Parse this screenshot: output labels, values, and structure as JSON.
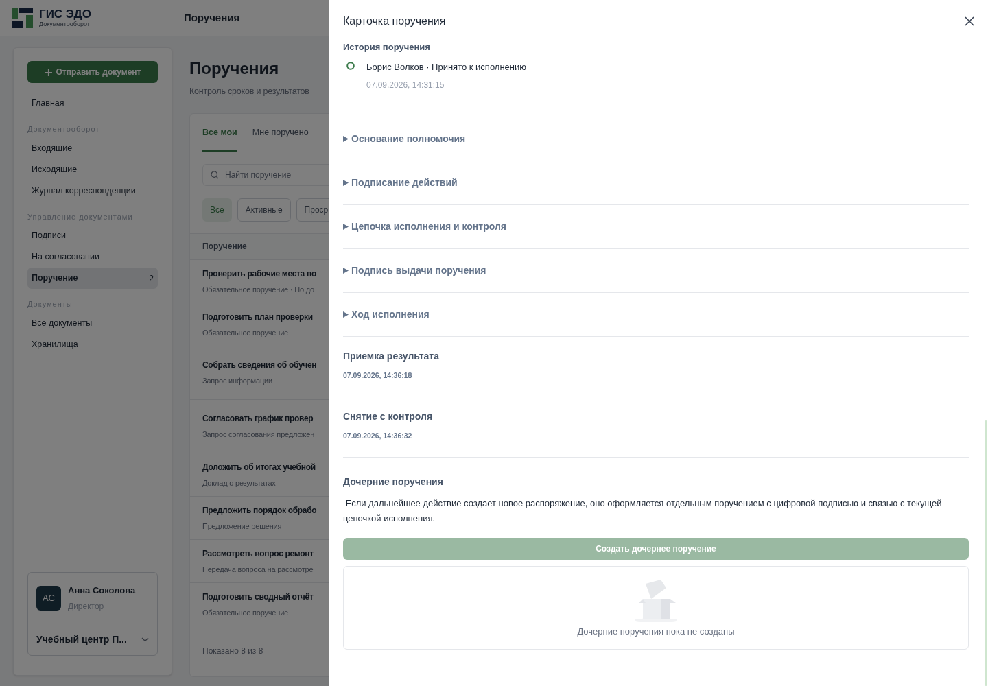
{
  "app": {
    "name": "ГИС ЭДО",
    "subtitle": "Документооборот",
    "page_title": "Поручения"
  },
  "sidebar": {
    "action": "Отправить документ",
    "items": [
      {
        "kind": "link",
        "label": "Главная",
        "selected": false
      },
      {
        "kind": "section",
        "label": "Документооборот"
      },
      {
        "kind": "link",
        "label": "Входящие",
        "selected": false
      },
      {
        "kind": "link",
        "label": "Исходящие",
        "selected": false
      },
      {
        "kind": "link",
        "label": "Журнал корреспонденции",
        "selected": false
      },
      {
        "kind": "section",
        "label": "Управление документами"
      },
      {
        "kind": "link",
        "label": "Подписи",
        "selected": false
      },
      {
        "kind": "link",
        "label": "На согласовании",
        "selected": false
      },
      {
        "kind": "link",
        "label": "Поручение",
        "selected": true,
        "count": "2"
      },
      {
        "kind": "section",
        "label": "Документы"
      },
      {
        "kind": "link",
        "label": "Все документы",
        "selected": false
      },
      {
        "kind": "link",
        "label": "Хранилища",
        "selected": false
      }
    ],
    "user": {
      "initials": "АС",
      "name": "Анна Соколова",
      "role": "Директор",
      "org": "Учебный центр П..."
    }
  },
  "main": {
    "title": "Поручения",
    "subtitle": "Контроль сроков и результатов",
    "tabs": [
      {
        "label": "Все мои",
        "selected": true
      },
      {
        "label": "Мне поручено",
        "selected": false
      }
    ],
    "search": {
      "placeholder": "Найти поручение"
    },
    "filters": [
      {
        "label": "Все",
        "selected": true
      },
      {
        "label": "Активные",
        "selected": false
      },
      {
        "label": "Проср",
        "selected": false
      }
    ],
    "column": "Поручение",
    "rows": [
      {
        "title": "Проверить рабочие места по",
        "meta": "Обязательное поручение · По до"
      },
      {
        "title": "Подготовить план проверки",
        "meta": "Обязательное поручение"
      },
      {
        "title": "Собрать сведения об обучен",
        "meta": "Запрос информации"
      },
      {
        "title": "Согласовать график провер",
        "meta": "Запрос согласования предложен"
      },
      {
        "title": "Доложить об итогах учебной",
        "meta": "Доклад о результатах"
      },
      {
        "title": "Предложить порядок обрабо",
        "meta": "Предложение решения"
      },
      {
        "title": "Рассмотреть вопрос ремонт",
        "meta": "Передача вопроса на рассмотре"
      },
      {
        "title": "Подготовить сводный отчёт",
        "meta": "Обязательное поручение"
      }
    ],
    "footer": "Показано 8 из 8"
  },
  "drawer": {
    "title": "Карточка поручения",
    "history": {
      "title": "История поручения",
      "events": [
        {
          "text": "Борис Волков · Принято к исполнению",
          "time": "07.09.2026, 14:31:15"
        }
      ]
    },
    "sections": [
      {
        "kind": "collapsed",
        "title": "Основание полномочия"
      },
      {
        "kind": "collapsed",
        "title": "Подписание действий"
      },
      {
        "kind": "collapsed",
        "title": "Цепочка исполнения и контроля"
      },
      {
        "kind": "collapsed",
        "title": "Подпись выдачи поручения"
      },
      {
        "kind": "collapsed",
        "title": "Ход исполнения"
      },
      {
        "kind": "dated",
        "title": "Приемка результата",
        "date": "07.09.2026, 14:36:18"
      },
      {
        "kind": "dated",
        "title": "Снятие с контроля",
        "date": "07.09.2026, 14:36:32"
      }
    ],
    "children": {
      "title": "Дочерние поручения",
      "note": " Если дальнейшее действие создает новое распоряжение, оно оформляется отдельным поручением с цифровой подписью и связью с текущей цепочкой исполнения.",
      "button": {
        "label": "Создать дочернее поручение",
        "disabled": true
      },
      "empty": "Дочерние поручения пока не созданы"
    }
  }
}
